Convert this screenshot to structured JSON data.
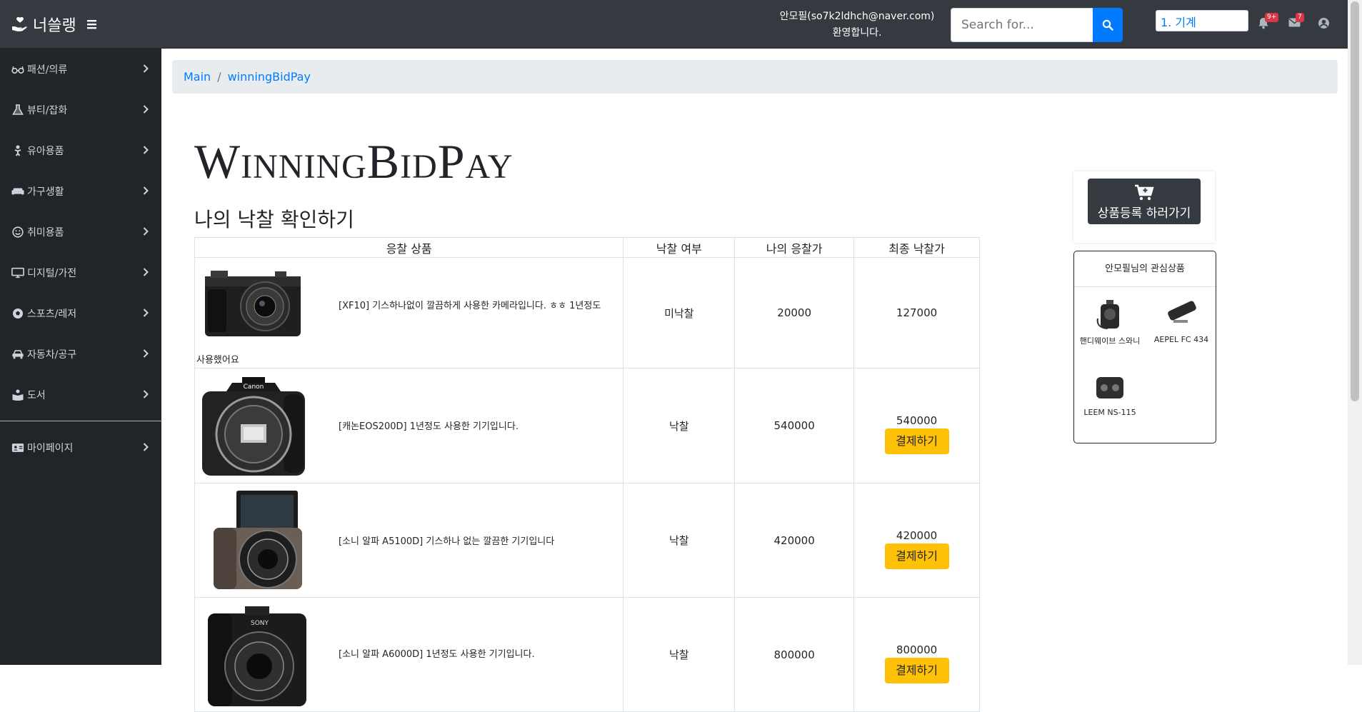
{
  "header": {
    "brand": "너쓸랭",
    "welcome_line1": "안모필(so7k2ldhch@naver.com)",
    "welcome_line2": "환영합니다.",
    "search_placeholder": "Search for...",
    "category_selected": "1. 기계",
    "alerts_badge": "9+",
    "messages_badge": "7"
  },
  "sidebar": {
    "items": [
      {
        "label": "패션/의류",
        "icon": "glasses-icon"
      },
      {
        "label": "뷰티/잡화",
        "icon": "flask-icon"
      },
      {
        "label": "유아용품",
        "icon": "baby-icon"
      },
      {
        "label": "가구생활",
        "icon": "couch-icon"
      },
      {
        "label": "취미용품",
        "icon": "smile-icon"
      },
      {
        "label": "디지털/가전",
        "icon": "desktop-icon"
      },
      {
        "label": "스포츠/레저",
        "icon": "soccer-ball-icon"
      },
      {
        "label": "자동차/공구",
        "icon": "car-icon"
      },
      {
        "label": "도서",
        "icon": "book-reader-icon"
      }
    ],
    "mypage": {
      "label": "마이페이지",
      "icon": "id-card-icon"
    }
  },
  "breadcrumb": {
    "home": "Main",
    "current": "winningBidPay"
  },
  "page": {
    "title": "WinningBidPay",
    "subtitle": "나의 낙찰 확인하기"
  },
  "table": {
    "headers": [
      "응찰 상품",
      "낙찰 여부",
      "나의 응찰가",
      "최종 낙찰가"
    ],
    "rows": [
      {
        "desc_line1": "[XF10] 기스하나없이 깔끔하게 사용한 카메라입니다. ㅎㅎ 1년정도",
        "desc_line2": "사용했어요",
        "status": "미낙찰",
        "my_bid": "20000",
        "final": "127000",
        "pay": ""
      },
      {
        "desc_line1": "[캐논EOS200D] 1년정도 사용한 기기입니다.",
        "desc_line2": "",
        "status": "낙찰",
        "my_bid": "540000",
        "final": "540000",
        "pay": "결제하기"
      },
      {
        "desc_line1": "[소니 알파 A5100D] 기스하나 없는 깔끔한 기기입니다",
        "desc_line2": "",
        "status": "낙찰",
        "my_bid": "420000",
        "final": "420000",
        "pay": "결제하기"
      },
      {
        "desc_line1": "[소니 알파 A6000D] 1년정도 사용한 기기입니다.",
        "desc_line2": "",
        "status": "낙찰",
        "my_bid": "800000",
        "final": "800000",
        "pay": "결제하기"
      }
    ]
  },
  "register": {
    "label": "상품등록 하러가기"
  },
  "interest": {
    "title": "안모필님의 관심상품",
    "items": [
      {
        "name": "핸디웨이브 스와니"
      },
      {
        "name": "AEPEL FC 434"
      },
      {
        "name": "LEEM NS-115"
      }
    ]
  },
  "colors": {
    "topbar": "#343a40",
    "sidebar": "#212529",
    "primary": "#007bff",
    "pay": "#ffc107"
  }
}
